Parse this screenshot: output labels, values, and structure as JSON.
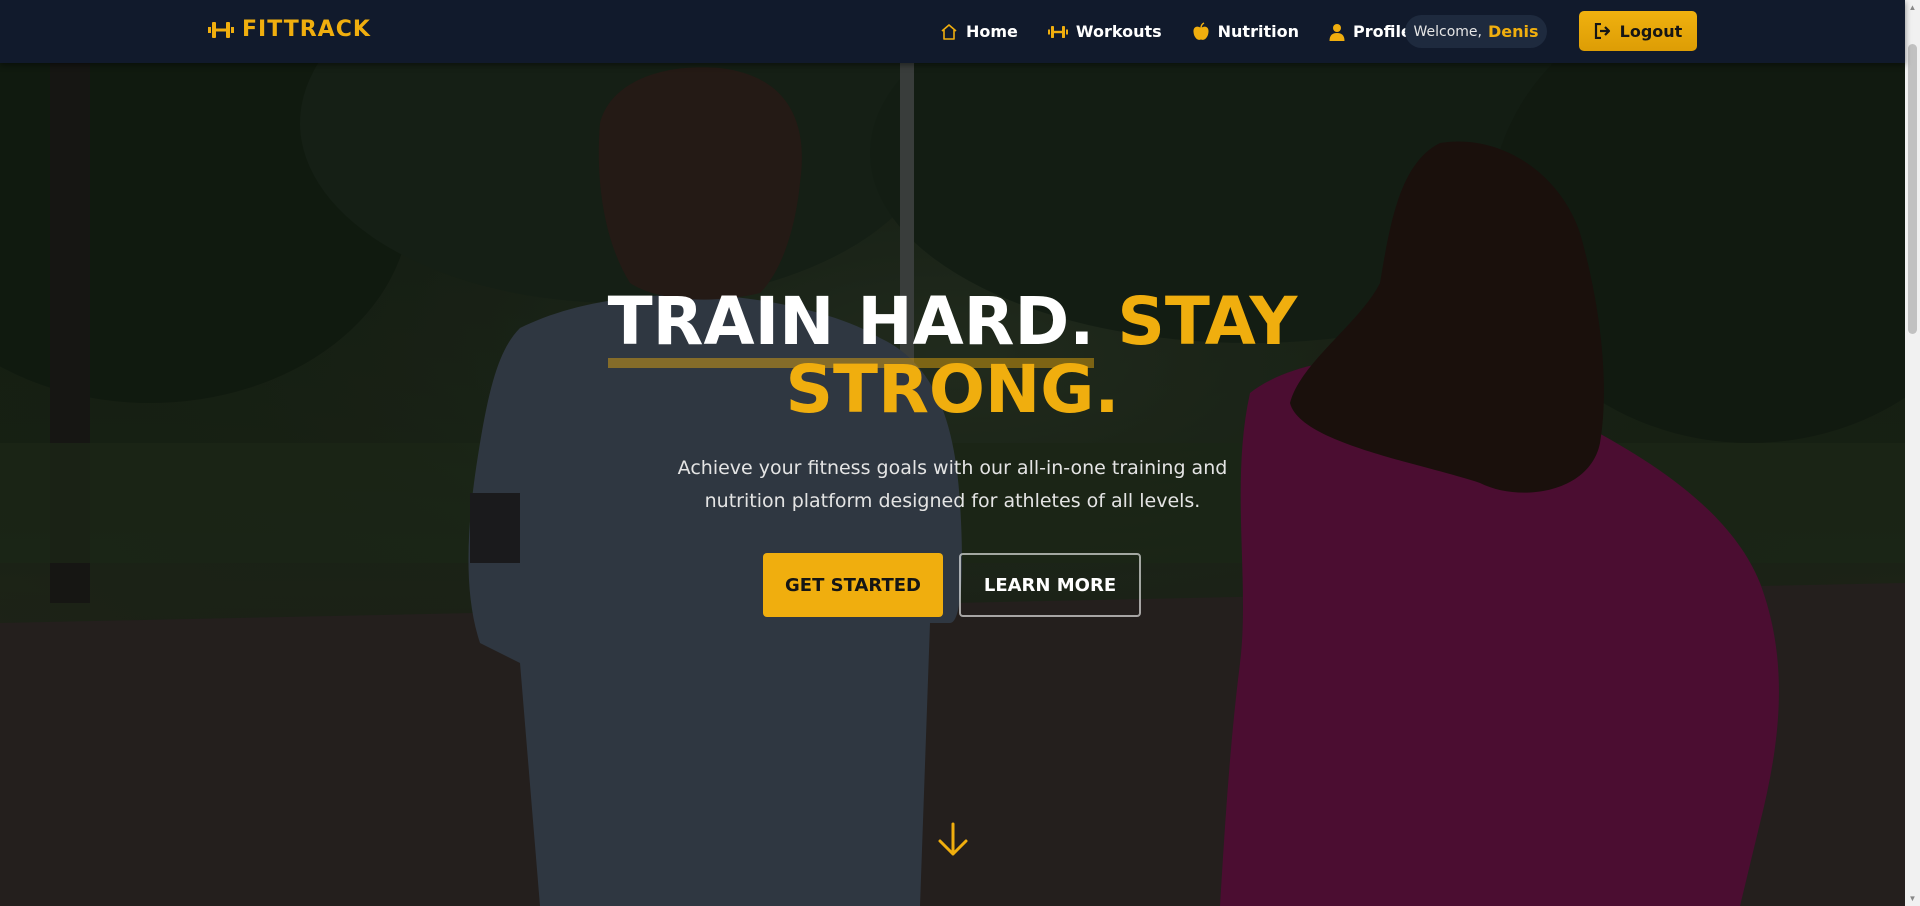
{
  "brand": {
    "name": "FITTRACK",
    "icon": "dumbbell-icon",
    "color": "#f0ae0e"
  },
  "nav": {
    "items": [
      {
        "label": "Home",
        "icon": "home-icon"
      },
      {
        "label": "Workouts",
        "icon": "dumbbell-icon"
      },
      {
        "label": "Nutrition",
        "icon": "apple-icon"
      },
      {
        "label": "Profile",
        "icon": "user-icon"
      }
    ],
    "welcome_label": "Welcome,",
    "user_name": "Denis",
    "logout_label": "Logout",
    "logout_icon": "logout-icon"
  },
  "hero": {
    "title_white": "TRAIN HARD.",
    "title_gold_1": "STAY",
    "title_gold_2": "STRONG.",
    "subtitle_line1": "Achieve your fitness goals with our all-in-one training and",
    "subtitle_line2": "nutrition platform designed for athletes of all levels.",
    "primary_cta": "GET STARTED",
    "secondary_cta": "LEARN MORE",
    "scroll_icon": "arrow-down-icon"
  },
  "colors": {
    "accent": "#f0ae0e",
    "navbar": "#111a2c"
  }
}
